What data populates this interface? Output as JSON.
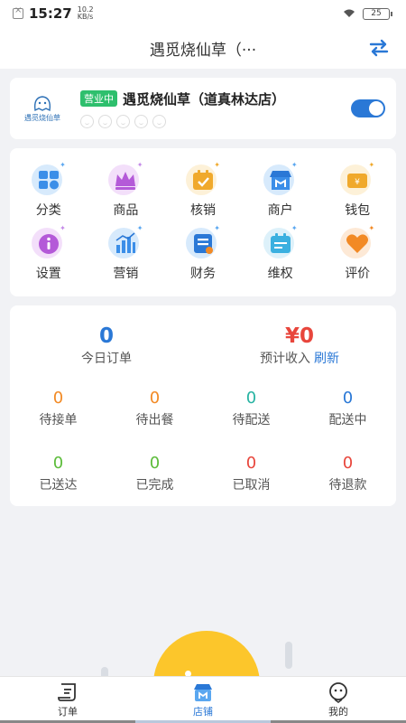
{
  "status_bar": {
    "time": "15:27",
    "net_speed_value": "10.2",
    "net_speed_unit": "KB/s",
    "battery": "25"
  },
  "header": {
    "title": "遇觅烧仙草（···"
  },
  "store": {
    "logo_text": "遇觅烧仙草",
    "status_badge": "营业中",
    "name": "遇觅烧仙草（道真林达店）",
    "rating_faces": 5,
    "open_toggle_on": true
  },
  "menu": [
    {
      "label": "分类",
      "icon": "category-icon",
      "color": "#3b8ee8"
    },
    {
      "label": "商品",
      "icon": "crown-icon",
      "color": "#b45ad8"
    },
    {
      "label": "核销",
      "icon": "calendar-check-icon",
      "color": "#f0a92c"
    },
    {
      "label": "商户",
      "icon": "shop-icon",
      "color": "#2a78d6"
    },
    {
      "label": "钱包",
      "icon": "wallet-icon",
      "color": "#f0a92c"
    },
    {
      "label": "设置",
      "icon": "info-settings-icon",
      "color": "#b45ad8"
    },
    {
      "label": "营销",
      "icon": "bar-chart-icon",
      "color": "#3b8ee8"
    },
    {
      "label": "财务",
      "icon": "finance-doc-icon",
      "color": "#2a78d6"
    },
    {
      "label": "维权",
      "icon": "calendar-edit-icon",
      "color": "#3bb0e0"
    },
    {
      "label": "评价",
      "icon": "heart-icon",
      "color": "#f28a25"
    }
  ],
  "stats": {
    "today_orders": {
      "value": "0",
      "label": "今日订单"
    },
    "expected_income": {
      "value": "¥0",
      "label": "预计收入",
      "refresh": "刷新"
    },
    "grid": [
      {
        "value": "0",
        "label": "待接单",
        "color": "orange"
      },
      {
        "value": "0",
        "label": "待出餐",
        "color": "orange"
      },
      {
        "value": "0",
        "label": "待配送",
        "color": "teal"
      },
      {
        "value": "0",
        "label": "配送中",
        "color": "blue"
      },
      {
        "value": "0",
        "label": "已送达",
        "color": "green"
      },
      {
        "value": "0",
        "label": "已完成",
        "color": "green"
      },
      {
        "value": "0",
        "label": "已取消",
        "color": "red"
      },
      {
        "value": "0",
        "label": "待退款",
        "color": "red"
      }
    ]
  },
  "tabs": [
    {
      "label": "订单",
      "icon": "order-icon",
      "active": false
    },
    {
      "label": "店铺",
      "icon": "store-icon",
      "active": true
    },
    {
      "label": "我的",
      "icon": "profile-icon",
      "active": false
    }
  ]
}
